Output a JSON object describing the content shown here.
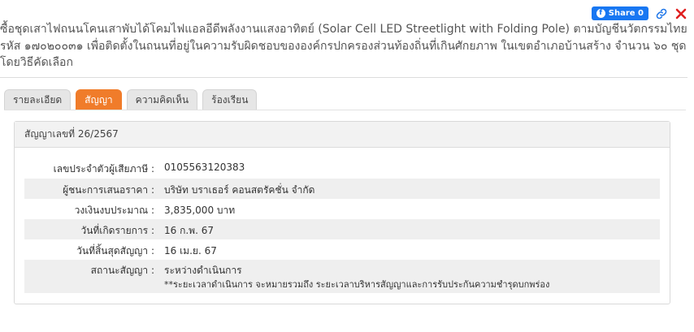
{
  "share": {
    "label": "Share 0",
    "icon": "facebook-icon"
  },
  "actions": {
    "link_icon": "link-icon",
    "close_icon": "close-icon",
    "accent": "#1877f2",
    "close_color": "#e02020"
  },
  "page": {
    "title": "ซื้อชุดเสาไฟถนนโคนเสาพับได้โคมไฟแอลอีดีพลังงานแสงอาทิตย์ (Solar Cell LED Streetlight with Folding Pole) ตามบัญชีนวัตกรรมไทย รหัส ๑๗๐๒๐๐๓๑ เพื่อติดตั้งในถนนที่อยู่ในความรับผิดชอบขององค์กรปกครองส่วนท้องถิ่นที่เกินศักยภาพ ในเขตอำเภอบ้านสร้าง จำนวน ๖๐ ชุด โดยวิธีคัดเลือก"
  },
  "tabs": [
    {
      "label": "รายละเอียด",
      "active": false
    },
    {
      "label": "สัญญา",
      "active": true
    },
    {
      "label": "ความคิดเห็น",
      "active": false
    },
    {
      "label": "ร้องเรียน",
      "active": false
    }
  ],
  "contract": {
    "header": "สัญญาเลขที่ 26/2567",
    "rows": [
      {
        "label": "เลขประจำตัวผู้เสียภาษี :",
        "value": "0105563120383"
      },
      {
        "label": "ผู้ชนะการเสนอราคา :",
        "value": "บริษัท บราเธอร์ คอนสตรัคชั่น จำกัด"
      },
      {
        "label": "วงเงินงบประมาณ :",
        "value": "3,835,000 บาท"
      },
      {
        "label": "วันที่เกิดรายการ :",
        "value": "16 ก.พ. 67"
      },
      {
        "label": "วันที่สิ้นสุดสัญญา :",
        "value": "16 เม.ย. 67"
      },
      {
        "label": "สถานะสัญญา :",
        "value": "ระหว่างดำเนินการ",
        "note": "**ระยะเวลาดำเนินการ จะหมายรวมถึง ระยะเวลาบริหารสัญญาและการรับประกันความชำรุดบกพร่อง"
      }
    ]
  }
}
